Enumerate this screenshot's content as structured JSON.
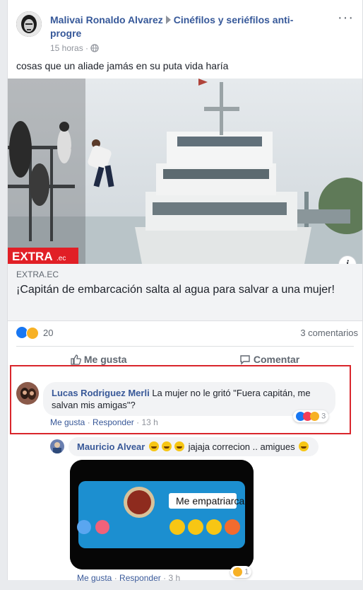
{
  "post": {
    "author": "Malivai Ronaldo Alvarez",
    "group": "Cinéfilos y seriéfilos anti-progre",
    "time": "15 horas",
    "text": "cosas que un aliade jamás en su puta vida haría",
    "more_label": "···"
  },
  "link": {
    "watermark": "EXTRA",
    "watermark_suffix": ".ec",
    "domain": "EXTRA.EC",
    "title": "¡Capitán de embarcación salta al agua para salvar a una mujer!"
  },
  "stats": {
    "reactions_count": "20",
    "comments_count": "3 comentarios"
  },
  "actions": {
    "like": "Me gusta",
    "comment": "Comentar"
  },
  "comments": [
    {
      "author": "Lucas Rodriguez Merli",
      "text": "La mujer no le gritó \"Fuera capitán, me salvan mis amigas\"?",
      "like": "Me gusta",
      "reply": "Responder",
      "time": "13 h",
      "reactions_count": "3"
    },
    {
      "author": "Mauricio Alvear",
      "text": "jajaja correcion .. amigues",
      "gif_label": "Me empatriarca",
      "like": "Me gusta",
      "reply": "Responder",
      "time": "3 h",
      "reactions_count": "1"
    }
  ],
  "colors": {
    "link": "#365899",
    "like_blue": "#1877f2",
    "haha_yellow": "#f7b125",
    "love_red": "#f33e58",
    "highlight_red": "#d9262c"
  },
  "icons": [
    "more-options-icon",
    "globe-icon",
    "info-icon",
    "like-reaction-icon",
    "haha-reaction-icon",
    "love-reaction-icon",
    "thumbs-up-icon",
    "comment-icon",
    "smile-emoji-icon"
  ]
}
